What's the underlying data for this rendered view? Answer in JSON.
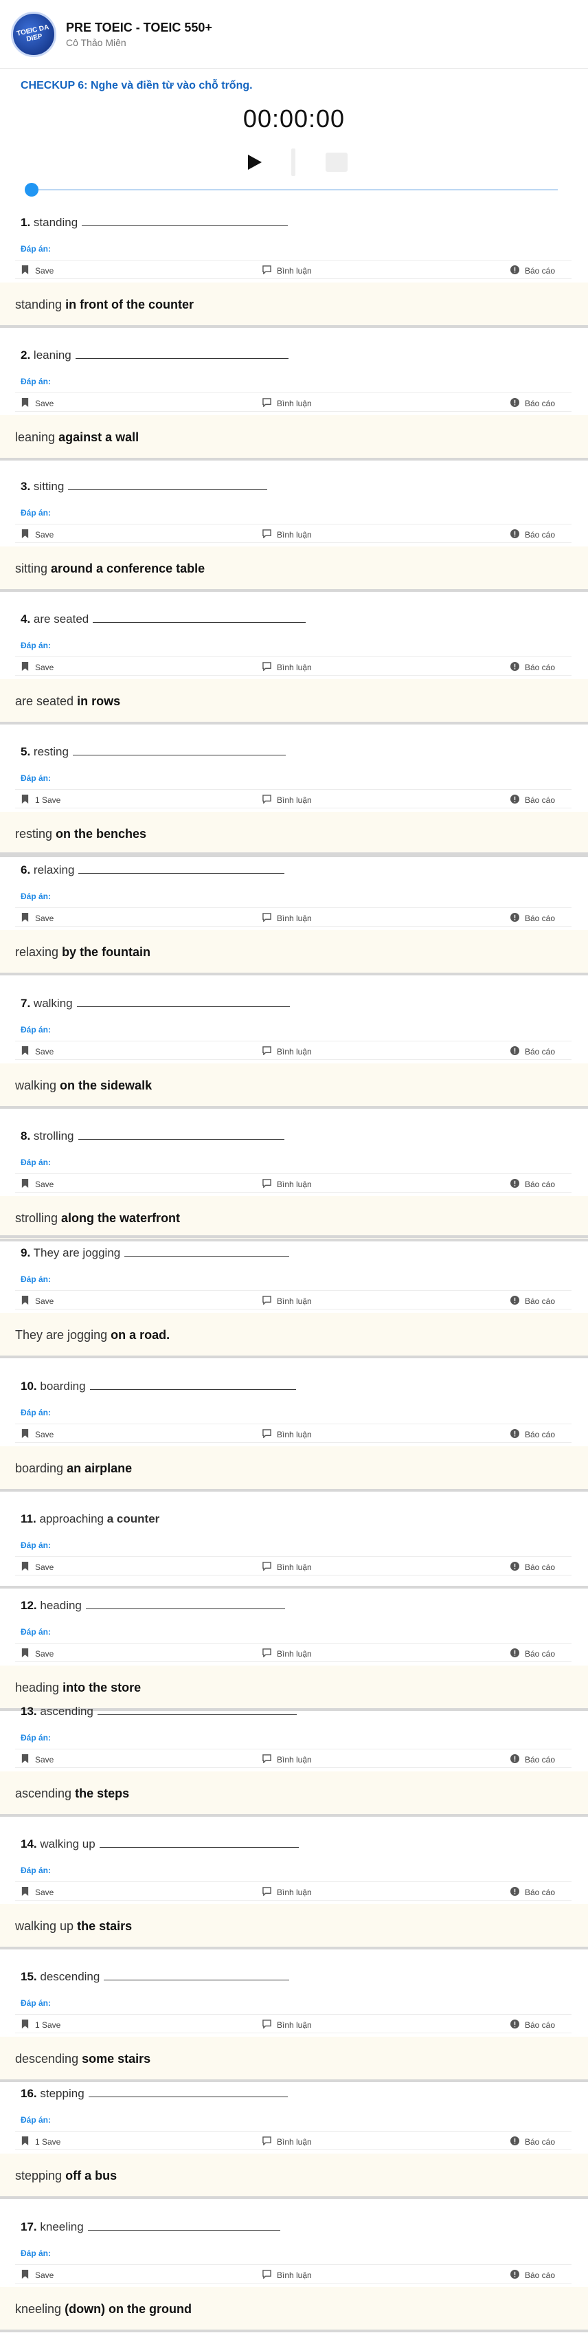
{
  "app": {
    "title": "PRE TOEIC - TOEIC 550+",
    "teacher": "Cô Thảo Miên",
    "logo_text": "TOEIC DA DIEP"
  },
  "checkup_title": "CHECKUP 6: Nghe và điền từ vào chỗ trống.",
  "player": {
    "time": "00:00:00",
    "play_icon": "play-icon",
    "stop_icon": "stop-icon",
    "progress": 0,
    "accent": "#2196f3"
  },
  "labels": {
    "answer": "Đáp án:",
    "comment": "Bình luận",
    "report": "Báo cáo"
  },
  "questions": [
    {
      "num": "1.",
      "prompt": "standing",
      "save": "Save",
      "ans_prefix": "standing",
      "ans_bold": "in front of the counter"
    },
    {
      "num": "2.",
      "prompt": "leaning",
      "save": "Save",
      "ans_prefix": "leaning",
      "ans_bold": "against a wall"
    },
    {
      "num": "3.",
      "prompt": "sitting",
      "save": "Save",
      "ans_prefix": "sitting",
      "ans_bold": "around a conference table"
    },
    {
      "num": "4.",
      "prompt": "are seated",
      "save": "Save",
      "ans_prefix": "are seated",
      "ans_bold": "in rows"
    },
    {
      "num": "5.",
      "prompt": "resting",
      "save": "1 Save",
      "ans_prefix": "resting",
      "ans_bold": "on the benches"
    },
    {
      "num": "6.",
      "prompt": "relaxing",
      "save": "Save",
      "ans_prefix": "relaxing",
      "ans_bold": "by the fountain"
    },
    {
      "num": "7.",
      "prompt": "walking",
      "save": "Save",
      "ans_prefix": "walking",
      "ans_bold": "on the sidewalk"
    },
    {
      "num": "8.",
      "prompt": "strolling",
      "save": "Save",
      "ans_prefix": "strolling",
      "ans_bold": "along the waterfront"
    },
    {
      "num": "9.",
      "prompt": "They are jogging",
      "save": "Save",
      "ans_prefix": "They are jogging",
      "ans_bold": "on a road."
    },
    {
      "num": "10.",
      "prompt": "boarding",
      "save": "Save",
      "ans_prefix": "boarding",
      "ans_bold": "an airplane"
    },
    {
      "num": "11.",
      "prompt": "approaching",
      "prompt_bold": "a counter",
      "save": "Save",
      "ans_prefix": "",
      "ans_bold": ""
    },
    {
      "num": "12.",
      "prompt": "heading",
      "save": "Save",
      "ans_prefix": "heading",
      "ans_bold": "into the store"
    },
    {
      "num": "13.",
      "prompt": "ascending",
      "save": "Save",
      "ans_prefix": "ascending",
      "ans_bold": "the steps"
    },
    {
      "num": "14.",
      "prompt": "walking up",
      "save": "Save",
      "ans_prefix": "walking up",
      "ans_bold": "the stairs"
    },
    {
      "num": "15.",
      "prompt": "descending",
      "save": "1 Save",
      "ans_prefix": "descending",
      "ans_bold": "some stairs"
    },
    {
      "num": "16.",
      "prompt": "stepping",
      "save": "1 Save",
      "ans_prefix": "stepping",
      "ans_bold": "off a bus"
    },
    {
      "num": "17.",
      "prompt": "kneeling",
      "save": "Save",
      "ans_prefix": "kneeling",
      "ans_bold": "(down) on the ground"
    }
  ]
}
